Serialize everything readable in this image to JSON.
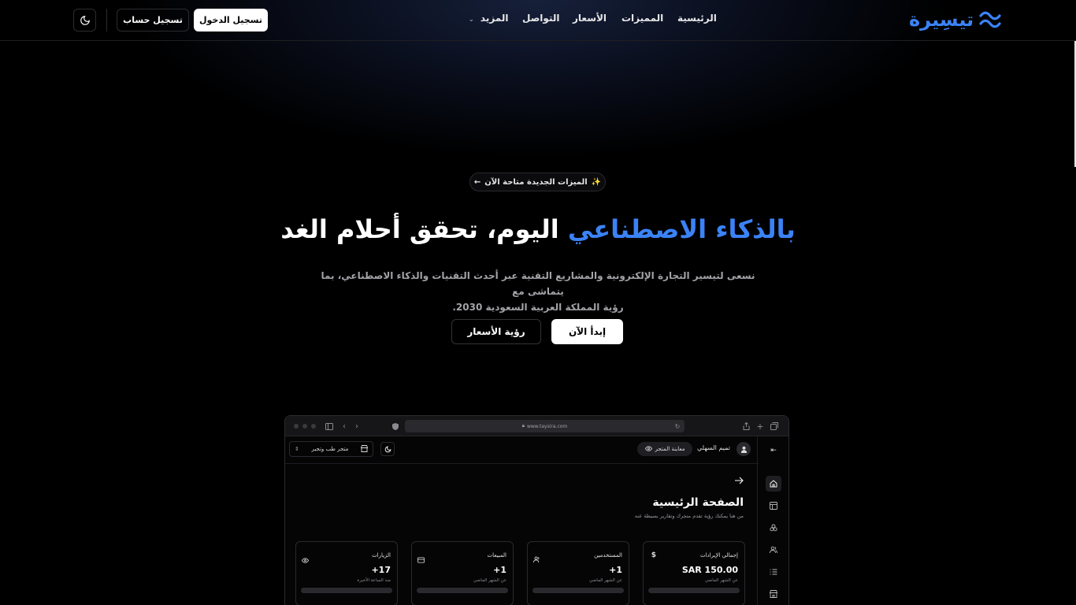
{
  "header": {
    "logo_text": "تيسِيرة",
    "nav": [
      {
        "label": "الرئيسية"
      },
      {
        "label": "المميزات"
      },
      {
        "label": "الأسعار"
      },
      {
        "label": "التواصل"
      },
      {
        "label": "المزيد"
      }
    ],
    "login_label": "تسجيل الدخول",
    "signup_label": "تسجيل حساب"
  },
  "hero": {
    "badge_icon": "✨",
    "badge_text": "الميزات الجديدة متاحة الآن",
    "badge_arrow": "←",
    "headline_highlight": "بالذكاء الاصطناعي",
    "headline_rest": "اليوم، تحقق أحلام الغد",
    "subtitle_line1": "نسعى لتيسير التجارة الإلكترونية والمشاريع التقنية عبر أحدث التقنيات والذكاء الاصطناعي، بما يتماشى مع",
    "subtitle_line2": "رؤية المملكة العربية السعودية 2030.",
    "start_label": "إبدأ الآن",
    "prices_label": "رؤية الأسعار"
  },
  "mockup": {
    "url": "www.taysira.com",
    "user_name": "تميم السهلي",
    "preview_label": "معاينة المتجر",
    "store_name": "متجر طب وتجبر",
    "page_title": "الصفحة الرئيسية",
    "page_subtitle": "من هنا يمكنك رؤية تقدم متجرك وتقارير بسيطة عنه",
    "cards": [
      {
        "label": "إجمالي الإيرادات",
        "value": "SAR 150.00",
        "note": "عن الشهر الماضي",
        "icon": "dollar-icon"
      },
      {
        "label": "المستخدمين",
        "value": "+1",
        "note": "عن الشهر الماضي",
        "icon": "users-icon"
      },
      {
        "label": "المبيعات",
        "value": "+1",
        "note": "عن الشهر الماضي",
        "icon": "card-icon"
      },
      {
        "label": "الزيارات",
        "value": "+17",
        "note": "منذ الساعة الأخيرة",
        "icon": "eye-icon"
      }
    ]
  },
  "colors": {
    "accent": "#3b82f6",
    "background": "#000000"
  }
}
